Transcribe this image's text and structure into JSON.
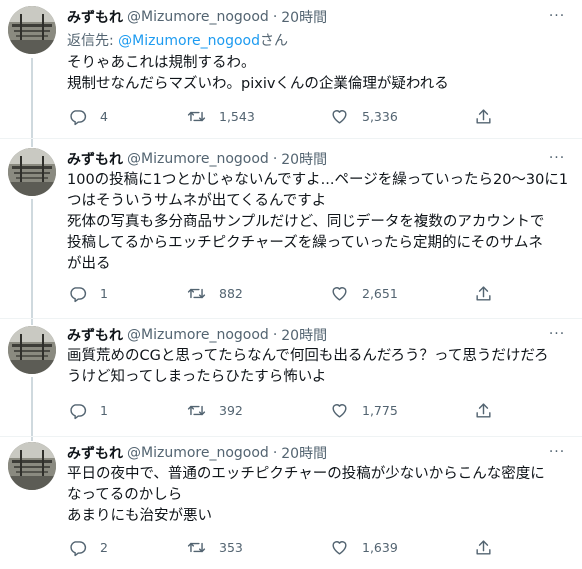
{
  "colors": {
    "accent": "#1d9bf0",
    "text": "#0f1419",
    "muted": "#536471",
    "border": "#eff3f4"
  },
  "tweets": [
    {
      "name": "みずもれ",
      "handle": "@Mizumore_nogood",
      "separator": "·",
      "time": "20時間",
      "reply_prefix": "返信先: ",
      "reply_mention": "@Mizumore_nogood",
      "reply_suffix": "さん",
      "lines": [
        "そりゃあこれは規制するわ。",
        "規制せなんだらマズいわ。pixivくんの企業倫理が疑われる"
      ],
      "replies": "4",
      "retweets": "1,543",
      "likes": "5,336"
    },
    {
      "name": "みずもれ",
      "handle": "@Mizumore_nogood",
      "separator": "·",
      "time": "20時間",
      "lines": [
        "100の投稿に1つとかじゃないんですよ...ページを繰っていったら20〜30に1",
        "つはそういうサムネが出てくるんですよ",
        "死体の写真も多分商品サンプルだけど、同じデータを複数のアカウントで",
        "投稿してるからエッチピクチャーズを繰っていったら定期的にそのサムネ",
        "が出る"
      ],
      "replies": "1",
      "retweets": "882",
      "likes": "2,651"
    },
    {
      "name": "みずもれ",
      "handle": "@Mizumore_nogood",
      "separator": "·",
      "time": "20時間",
      "lines": [
        "画質荒めのCGと思ってたらなんで何回も出るんだろう？って思うだけだろ",
        "うけど知ってしまったらひたすら怖いよ"
      ],
      "replies": "1",
      "retweets": "392",
      "likes": "1,775"
    },
    {
      "name": "みずもれ",
      "handle": "@Mizumore_nogood",
      "separator": "·",
      "time": "20時間",
      "lines": [
        "平日の夜中で、普通のエッチピクチャーの投稿が少ないからこんな密度に",
        "なってるのかしら",
        "あまりにも治安が悪い"
      ],
      "replies": "2",
      "retweets": "353",
      "likes": "1,639"
    }
  ]
}
